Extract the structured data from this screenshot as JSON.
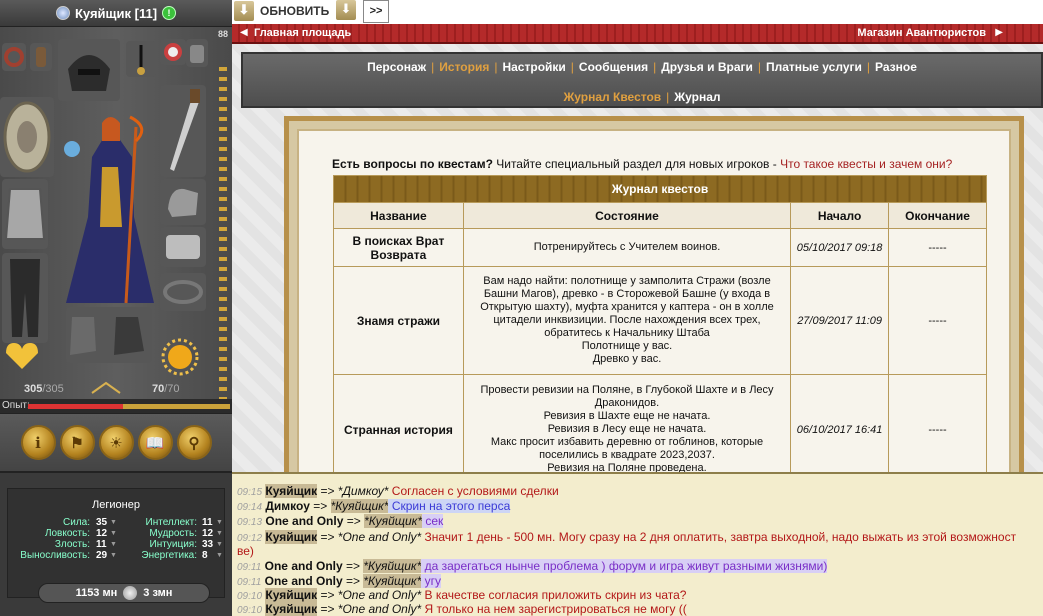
{
  "character": {
    "name": "Куяйщик [11]",
    "online_mark": "!",
    "level_corner": "88",
    "hp": "305",
    "hp_max": "/305",
    "mp": "70",
    "mp_max": "/70",
    "exp_label": "Опыт:",
    "rank": "Легионер",
    "money": "1153 мн",
    "secondary_money": "3 змн",
    "stats_left": [
      {
        "label": "Сила:",
        "value": "35"
      },
      {
        "label": "Ловкость:",
        "value": "12"
      },
      {
        "label": "Злость:",
        "value": "11"
      },
      {
        "label": "Выносливость:",
        "value": "29"
      }
    ],
    "stats_right": [
      {
        "label": "Интеллект:",
        "value": "11"
      },
      {
        "label": "Мудрость:",
        "value": "12"
      },
      {
        "label": "Интуиция:",
        "value": "33"
      },
      {
        "label": "Энергетика:",
        "value": "8"
      }
    ],
    "action_icons": [
      "i",
      "⚑",
      "☀",
      "📖",
      "⚲"
    ]
  },
  "topbar": {
    "refresh_label": "ОБНОВИТЬ",
    "more_label": ">>",
    "arrow": "⬇"
  },
  "redbar": {
    "left_location": "Главная площадь",
    "right_location": "Магазин Авантюристов"
  },
  "nav": {
    "row1": [
      "Персонаж",
      "История",
      "Настройки",
      "Сообщения",
      "Друзья и Враги",
      "Платные услуги",
      "Разное"
    ],
    "row1_active": "История",
    "row2": [
      "Журнал Квестов",
      "Журнал"
    ],
    "row2_active": "Журнал Квестов",
    "separator": "|"
  },
  "journal": {
    "faq_bold": "Есть вопросы по квестам?",
    "faq_text": " Читайте специальный раздел для новых игроков - ",
    "faq_link": "Что такое квесты и зачем они?",
    "table_title": "Журнал квестов",
    "columns": [
      "Название",
      "Состояние",
      "Начало",
      "Окончание"
    ],
    "rows": [
      {
        "name": "В поисках Врат Возврата",
        "state": [
          "Потренируйтесь с Учителем воинов."
        ],
        "start": "05/10/2017 09:18",
        "end": "-----"
      },
      {
        "name": "Знамя стражи",
        "state": [
          "Вам надо найти: полотнище у замполита Стражи (возле Башни Магов), древко - в Сторожевой Башне (у входа в Открытую шахту), муфта хранится у каптера - он в холле цитадели инквизиции. После нахождения всех трех, обратитесь к Начальнику Штаба",
          "Полотнище у вас.",
          "Древко у вас."
        ],
        "start": "27/09/2017 11:09",
        "end": "-----"
      },
      {
        "name": "Странная история",
        "state": [
          "Провести ревизии на Поляне, в Глубокой Шахте и в Лесу Драконидов.",
          "Ревизия в Шахте еще не начата.",
          "Ревизия в Лесу еще не начата.",
          "Макс просит избавить деревню от гоблинов, которые поселились в квадрате 2023,2037.",
          "Ревизия на Поляне проведена."
        ],
        "start": "06/10/2017 16:41",
        "end": "-----"
      }
    ]
  },
  "chat": {
    "lines": [
      {
        "time": "09:15",
        "user": "Куяйщик",
        "user_hl": true,
        "arrow": " => ",
        "to": "*Димкоу*",
        "to_hl": false,
        "msg": " Согласен с условиями сделки",
        "style": "red"
      },
      {
        "time": "09:14",
        "user": "Димкоу",
        "user_hl": false,
        "arrow": " => ",
        "to": "*Куяйщик*",
        "to_hl": true,
        "msg": " Скрин на этого перса",
        "style": "blue"
      },
      {
        "time": "09:13",
        "user": "One and Only",
        "user_hl": false,
        "arrow": " => ",
        "to": "*Куяйщик*",
        "to_hl": true,
        "msg": " сек",
        "style": "purple"
      },
      {
        "time": "09:12",
        "user": "Куяйщик",
        "user_hl": true,
        "arrow": " => ",
        "to": "*One and Only*",
        "to_hl": false,
        "msg": " Значит 1 день - 500 мн. Могу сразу на 2 дня оплатить, завтра выходной, надо выжать из этой возможност",
        "style": "red"
      },
      {
        "time": "",
        "user": "",
        "user_hl": false,
        "arrow": "",
        "to": "",
        "to_hl": false,
        "msg": "ве)",
        "style": "red"
      },
      {
        "time": "09:11",
        "user": "One and Only",
        "user_hl": false,
        "arrow": " => ",
        "to": "*Куяйщик*",
        "to_hl": true,
        "msg": " да зарегаться нынче проблема ) форум и игра живут разными жизнями)",
        "style": "purple"
      },
      {
        "time": "09:11",
        "user": "One and Only",
        "user_hl": false,
        "arrow": " => ",
        "to": "*Куяйщик*",
        "to_hl": true,
        "msg": " угу",
        "style": "purple"
      },
      {
        "time": "09:10",
        "user": "Куяйщик",
        "user_hl": true,
        "arrow": " => ",
        "to": "*One and Only*",
        "to_hl": false,
        "msg": " В качестве согласия приложить скрин из чата?",
        "style": "red"
      },
      {
        "time": "09:10",
        "user": "Куяйщик",
        "user_hl": true,
        "arrow": " => ",
        "to": "*One and Only*",
        "to_hl": false,
        "msg": " Я только на нем зарегистрироваться не могу ((",
        "style": "red"
      }
    ]
  }
}
